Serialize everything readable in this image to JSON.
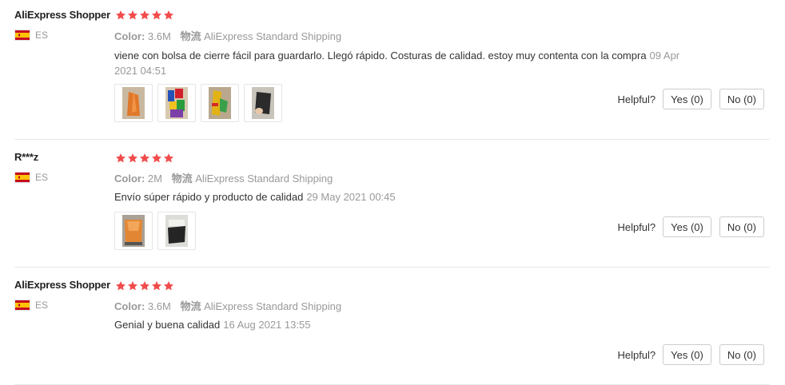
{
  "helpful_label": "Helpful?",
  "colors": {
    "star": "#f14c4c",
    "meta": "#999999",
    "text": "#333333",
    "divider": "#e8e8e8"
  },
  "reviews": [
    {
      "user": "AliExpress Shopper",
      "country_code": "ES",
      "rating": 5,
      "color_label": "Color:",
      "color_value": "3.6M",
      "shipping_label": "物流",
      "shipping_value": "AliExpress Standard Shipping",
      "text": "viene con bolsa de cierre fácil para guardarlo. Llegó rápido. Costuras de calidad. estoy muy contenta con la compra",
      "date": "09 Apr 2021 04:51",
      "photos": [
        "photo-1",
        "photo-2",
        "photo-3",
        "photo-4"
      ],
      "yes": "Yes (0)",
      "no": "No (0)"
    },
    {
      "user": "R***z",
      "country_code": "ES",
      "rating": 5,
      "color_label": "Color:",
      "color_value": "2M",
      "shipping_label": "物流",
      "shipping_value": "AliExpress Standard Shipping",
      "text": "Envío súper rápido y producto de calidad",
      "date": "29 May 2021 00:45",
      "photos": [
        "photo-1",
        "photo-2"
      ],
      "yes": "Yes (0)",
      "no": "No (0)"
    },
    {
      "user": "AliExpress Shopper",
      "country_code": "ES",
      "rating": 5,
      "color_label": "Color:",
      "color_value": "3.6M",
      "shipping_label": "物流",
      "shipping_value": "AliExpress Standard Shipping",
      "text": "Genial y buena calidad",
      "date": "16 Aug 2021 13:55",
      "photos": [],
      "yes": "Yes (0)",
      "no": "No (0)"
    }
  ]
}
